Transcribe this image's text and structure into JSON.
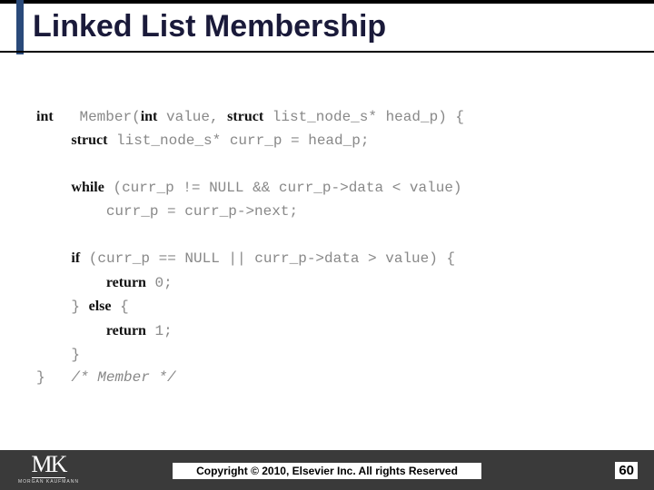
{
  "title": "Linked List Membership",
  "code": {
    "l1": {
      "kw1": "int",
      "t1": "   Member(",
      "kw2": "int",
      "t2": " value, ",
      "kw3": "struct",
      "t3": " list_node_s* head_p) {"
    },
    "l2": {
      "kw1": "struct",
      "t1": " list_node_s* curr_p = head_p;"
    },
    "l3": {
      "kw1": "while",
      "t1": " (curr_p != NULL && curr_p->data < value)"
    },
    "l4": {
      "t1": "curr_p = curr_p->next;"
    },
    "l5": {
      "kw1": "if",
      "t1": " (curr_p == NULL || curr_p->data > value) {"
    },
    "l6": {
      "kw1": "return",
      "t1": " 0;"
    },
    "l7": {
      "t1": "} ",
      "kw1": "else",
      "t2": " {"
    },
    "l8": {
      "kw1": "return",
      "t1": " 1;"
    },
    "l9": {
      "t1": "}"
    },
    "l10": {
      "t1": "}   ",
      "cm": "/* Member */"
    }
  },
  "logo": {
    "initials": "MK",
    "sub": "MORGAN KAUFMANN"
  },
  "footer": {
    "copyright": "Copyright © 2010, Elsevier Inc. All rights Reserved",
    "page": "60"
  }
}
